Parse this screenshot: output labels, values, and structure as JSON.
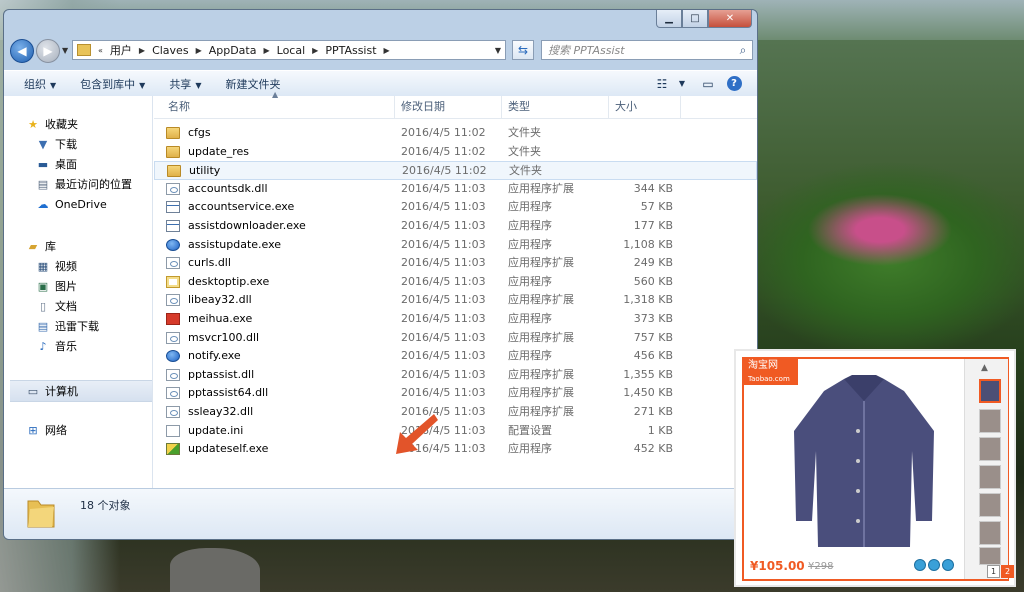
{
  "address": {
    "crumbs": [
      "用户",
      "Claves",
      "AppData",
      "Local",
      "PPTAssist"
    ]
  },
  "search": {
    "placeholder": "搜索 PPTAssist"
  },
  "toolbar": {
    "organize": "组织",
    "include_in_library": "包含到库中",
    "share": "共享",
    "new_folder": "新建文件夹"
  },
  "sidebar": {
    "favorites": {
      "label": "收藏夹",
      "items": [
        "下载",
        "桌面",
        "最近访问的位置",
        "OneDrive"
      ]
    },
    "library": {
      "label": "库",
      "items": [
        "视频",
        "图片",
        "文档",
        "迅雷下载",
        "音乐"
      ]
    },
    "computer": "计算机",
    "network": "网络"
  },
  "columns": {
    "name": "名称",
    "date": "修改日期",
    "type": "类型",
    "size": "大小"
  },
  "files": [
    {
      "name": "cfgs",
      "date": "2016/4/5 11:02",
      "type": "文件夹",
      "size": "",
      "icon": "folder"
    },
    {
      "name": "update_res",
      "date": "2016/4/5 11:02",
      "type": "文件夹",
      "size": "",
      "icon": "folder"
    },
    {
      "name": "utility",
      "date": "2016/4/5 11:02",
      "type": "文件夹",
      "size": "",
      "icon": "folder",
      "selected": true
    },
    {
      "name": "accountsdk.dll",
      "date": "2016/4/5 11:03",
      "type": "应用程序扩展",
      "size": "344 KB",
      "icon": "dll"
    },
    {
      "name": "accountservice.exe",
      "date": "2016/4/5 11:03",
      "type": "应用程序",
      "size": "57 KB",
      "icon": "exe"
    },
    {
      "name": "assistdownloader.exe",
      "date": "2016/4/5 11:03",
      "type": "应用程序",
      "size": "177 KB",
      "icon": "exe"
    },
    {
      "name": "assistupdate.exe",
      "date": "2016/4/5 11:03",
      "type": "应用程序",
      "size": "1,108 KB",
      "icon": "blue"
    },
    {
      "name": "curls.dll",
      "date": "2016/4/5 11:03",
      "type": "应用程序扩展",
      "size": "249 KB",
      "icon": "dll"
    },
    {
      "name": "desktoptip.exe",
      "date": "2016/4/5 11:03",
      "type": "应用程序",
      "size": "560 KB",
      "icon": "tip"
    },
    {
      "name": "libeay32.dll",
      "date": "2016/4/5 11:03",
      "type": "应用程序扩展",
      "size": "1,318 KB",
      "icon": "dll"
    },
    {
      "name": "meihua.exe",
      "date": "2016/4/5 11:03",
      "type": "应用程序",
      "size": "373 KB",
      "icon": "red"
    },
    {
      "name": "msvcr100.dll",
      "date": "2016/4/5 11:03",
      "type": "应用程序扩展",
      "size": "757 KB",
      "icon": "dll"
    },
    {
      "name": "notify.exe",
      "date": "2016/4/5 11:03",
      "type": "应用程序",
      "size": "456 KB",
      "icon": "blue"
    },
    {
      "name": "pptassist.dll",
      "date": "2016/4/5 11:03",
      "type": "应用程序扩展",
      "size": "1,355 KB",
      "icon": "dll"
    },
    {
      "name": "pptassist64.dll",
      "date": "2016/4/5 11:03",
      "type": "应用程序扩展",
      "size": "1,450 KB",
      "icon": "dll"
    },
    {
      "name": "ssleay32.dll",
      "date": "2016/4/5 11:03",
      "type": "应用程序扩展",
      "size": "271 KB",
      "icon": "dll"
    },
    {
      "name": "update.ini",
      "date": "2016/4/5 11:03",
      "type": "配置设置",
      "size": "1 KB",
      "icon": "ini"
    },
    {
      "name": "updateself.exe",
      "date": "2016/4/5 11:03",
      "type": "应用程序",
      "size": "452 KB",
      "icon": "green"
    }
  ],
  "status": {
    "count": "18 个对象"
  },
  "ad": {
    "logo": "淘宝网",
    "logo_sub": "Taobao.com",
    "price": "¥105.00",
    "old_price": "¥298",
    "pages": [
      "1",
      "2"
    ]
  },
  "colors": {
    "accent": "#f05a23",
    "arrow": "#e2542a"
  }
}
